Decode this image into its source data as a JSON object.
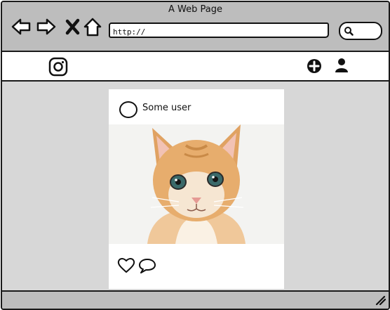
{
  "window": {
    "title": "A Web Page"
  },
  "browser": {
    "url": "http://",
    "buttons": [
      "back",
      "forward",
      "stop",
      "home"
    ]
  },
  "app": {
    "logo": "instagram-icon",
    "toolbar_icons": [
      "add-circle-icon",
      "user-icon"
    ]
  },
  "post": {
    "username": "Some user",
    "image": "orange-kitten-photo",
    "actions": [
      "heart-icon",
      "comment-icon"
    ]
  },
  "colors": {
    "chrome": "#bdbdbd",
    "background": "#d7d7d7",
    "card": "#ffffff",
    "stroke": "#111111"
  }
}
